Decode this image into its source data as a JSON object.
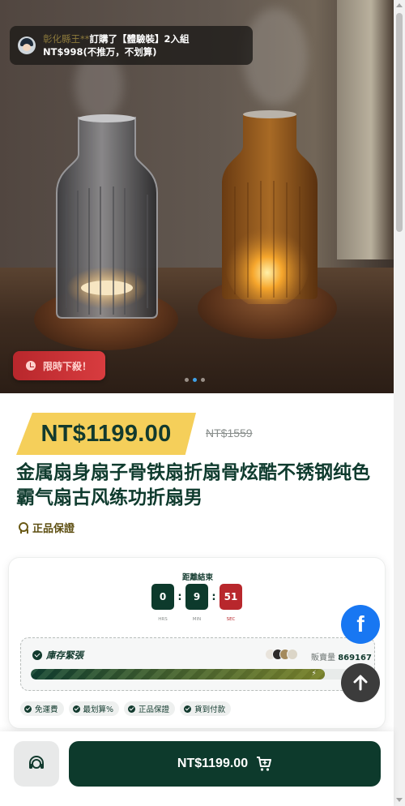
{
  "notice": {
    "buyer": "彰化縣王**",
    "action": "訂購了【體驗裝】2入組",
    "detail": "NT$998(不推万，不划算)"
  },
  "hero": {
    "badge_label": "限時下殺！",
    "slide_count": 3,
    "active_slide": 2
  },
  "product": {
    "price": "NT$1199.00",
    "original_price": "NT$1559",
    "title": "金属扇身扇子骨铁扇折扇骨炫酷不锈钢纯色霸气扇古风练功折扇男",
    "genuine_label": "正品保證"
  },
  "countdown": {
    "label": "距離結束",
    "hours": "0",
    "minutes": "9",
    "seconds": "51",
    "unit_hours": "HRS",
    "unit_minutes": "MIN",
    "unit_seconds": "SEC"
  },
  "stock": {
    "label": "庫存緊張",
    "sold_label": "販賣量",
    "sold_count": "869167",
    "progress": 0.88
  },
  "guarantees": [
    "免運費",
    "最划算%",
    "正品保證",
    "貨到付款"
  ],
  "bottom_bar": {
    "buy_label": "NT$1199.00"
  },
  "colors": {
    "brand_dark_green": "#0d3a2c",
    "price_highlight": "#f5cf5a",
    "alert_red": "#b8272c",
    "facebook_blue": "#1877f2"
  },
  "icons": [
    "avatar",
    "clock-icon",
    "ribbon-icon",
    "check-icon",
    "lightning-icon",
    "facebook-icon",
    "arrow-up-icon",
    "customer-service-icon",
    "cart-icon"
  ]
}
